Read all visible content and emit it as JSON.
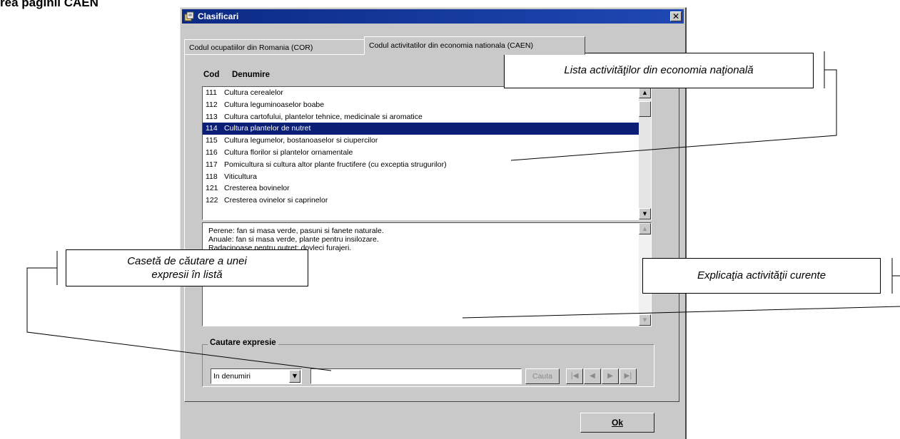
{
  "doc_heading": "rea paginii CAEN",
  "dialog": {
    "title": "Clasificari",
    "close_glyph": "✕",
    "tabs": [
      {
        "label": "Codul ocupatiilor din Romania (COR)"
      },
      {
        "label": "Codul activitatilor din economia nationala (CAEN)"
      }
    ],
    "columns": {
      "code": "Cod",
      "name": "Denumire"
    },
    "list": [
      {
        "code": "111",
        "name": "Cultura cerealelor"
      },
      {
        "code": "112",
        "name": "Cultura leguminoaselor boabe"
      },
      {
        "code": "113",
        "name": "Cultura cartofului, plantelor tehnice, medicinale si aromatice"
      },
      {
        "code": "114",
        "name": "Cultura plantelor de nutret",
        "selected": true
      },
      {
        "code": "115",
        "name": "Cultura legumelor, bostanoaselor si ciupercilor"
      },
      {
        "code": "116",
        "name": "Cultura florilor si plantelor ornamentale"
      },
      {
        "code": "117",
        "name": "Pomicultura si cultura altor plante fructifere (cu exceptia strugurilor)"
      },
      {
        "code": "118",
        "name": "Viticultura"
      },
      {
        "code": "121",
        "name": "Cresterea bovinelor"
      },
      {
        "code": "122",
        "name": "Cresterea ovinelor si caprinelor"
      }
    ],
    "explanation": [
      "Perene: fan si masa verde, pasuni si fanete naturale.",
      "Anuale: fan si masa verde, plante pentru insilozare.",
      "Radacinoase pentru nutret; dovleci furajeri."
    ],
    "search": {
      "group_label": "Cautare expresie",
      "scope_value": "In denumiri",
      "input_value": "",
      "find_label": "Cauta",
      "nav": [
        "|◀",
        "◀",
        "▶",
        "▶|"
      ]
    },
    "ok_label": "Ok"
  },
  "annotations": {
    "list_label": "Lista activităţilor din economia naţională",
    "search_label_line1": "Casetă de căutare a unei",
    "search_label_line2": "expresii în listă",
    "explanation_label": "Explicaţia activităţii curente"
  }
}
